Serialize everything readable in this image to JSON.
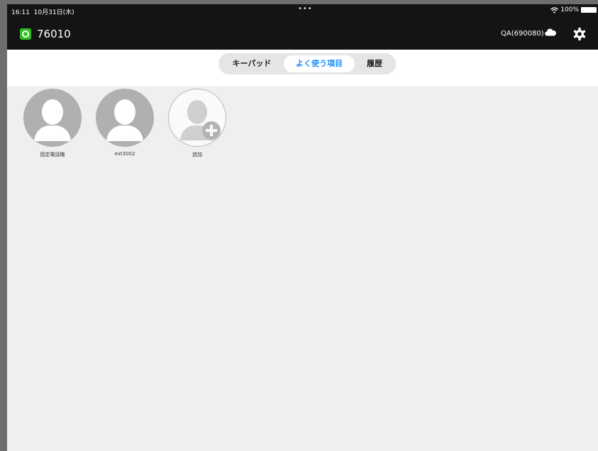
{
  "status_bar": {
    "time": "16:11",
    "date": "10月31日(木)",
    "dots": "•••",
    "battery": "100%"
  },
  "nav": {
    "account_number": "76010",
    "account_label": "QA(690080)"
  },
  "tabs": [
    {
      "label": "キーパッド",
      "active": false
    },
    {
      "label": "よく使う項目",
      "active": true
    },
    {
      "label": "履歴",
      "active": false
    }
  ],
  "favorites": [
    {
      "name": "固定電話機"
    },
    {
      "name": "ext3002"
    },
    {
      "name": "追加"
    }
  ],
  "colors": {
    "accent": "#1a8cff",
    "logo": "#2ec11f",
    "bar": "#141414",
    "background": "#efefef"
  },
  "icons": [
    "wifi-icon",
    "battery-icon",
    "cloud-icon",
    "gear-icon",
    "person-silhouette-icon",
    "plus-icon"
  ]
}
